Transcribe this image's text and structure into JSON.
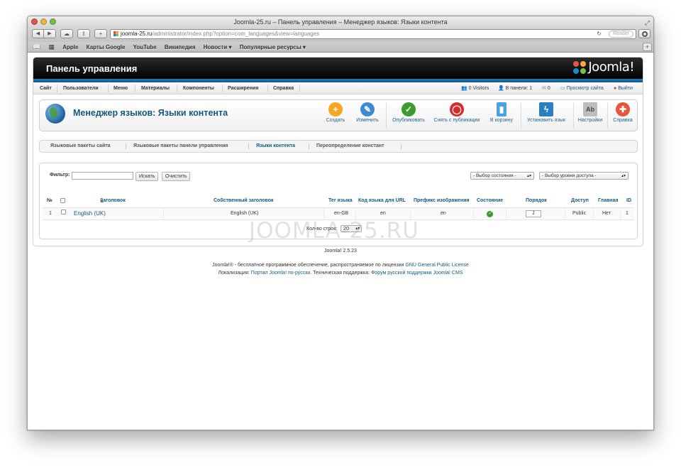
{
  "browser": {
    "title": "Joomla-25.ru – Панель управления – Менеджер языков: Языки контента",
    "url_domain": "joomla-25.ru",
    "url_path": "/administrator/index.php?option=com_languages&view=languages",
    "reader_label": "Reader",
    "bookmarks": [
      "Apple",
      "Карты Google",
      "YouTube",
      "Википедия",
      "Новости ▾",
      "Популярные ресурсы ▾"
    ]
  },
  "header": {
    "title": "Панель управления",
    "logo_text": "Joomla!"
  },
  "menu": {
    "items": [
      "Сайт",
      "Пользователи",
      "Меню",
      "Материалы",
      "Компоненты",
      "Расширения",
      "Справка"
    ],
    "status": {
      "visitors": "0 Visitors",
      "in_panel": "В панели: 1",
      "messages": "0",
      "view_site": "Просмотр сайта",
      "logout": "Выйти"
    }
  },
  "toolbar": {
    "title": "Менеджер языков: Языки контента",
    "buttons": {
      "create": "Создать",
      "edit": "Изменить",
      "publish": "Опубликовать",
      "unpublish": "Снять с публикации",
      "trash": "В корзину",
      "install": "Установить язык",
      "options": "Настройки",
      "help": "Справка"
    }
  },
  "tabs": [
    "Языковые пакеты сайта",
    "Языковые пакеты панели управления",
    "Языки контента",
    "Переопределение констант"
  ],
  "filter": {
    "label": "Фильтр:",
    "search_value": "",
    "search_button": "Искать",
    "clear_button": "Очистить",
    "state_select": "- Выбор состояния -",
    "access_select": "- Выбор уровня доступа -"
  },
  "table": {
    "headers": {
      "num": "№",
      "title": "Заголовок",
      "native_title": "Собственный заголовок",
      "lang_tag": "Тег языка",
      "url_code": "Код языка для URL",
      "image_prefix": "Префикс изображения",
      "state": "Состояние",
      "order": "Порядок",
      "access": "Доступ",
      "home": "Главная",
      "id": "ID"
    },
    "rows": [
      {
        "num": "1",
        "title": "English (UK)",
        "native_title": "English (UK)",
        "lang_tag": "en-GB",
        "url_code": "en",
        "image_prefix": "en",
        "order": "1",
        "access": "Public",
        "home": "Нет",
        "id": "1"
      }
    ],
    "rows_label": "Кол-во строк:",
    "rows_value": "20"
  },
  "watermark": "JOOMLA-25.RU",
  "footer": {
    "version": "Joomla! 2.5.23",
    "line2_prefix": "Joomla!® - бесплатное программное обеспечение, распространяемое по лицензии",
    "line2_link": "GNU General Public License",
    "line3_prefix": "Локализация:",
    "line3_link1": "Портал Joomla! по-русски",
    "line3_mid": ". Техническая поддержка:",
    "line3_link2": "Форум русской поддержки Joomla! CMS"
  }
}
